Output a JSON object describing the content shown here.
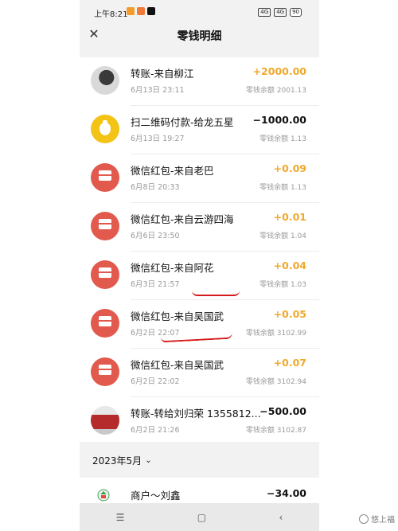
{
  "status_bar": {
    "time": "上午8:21",
    "net_left": "4G",
    "net_right": "4G",
    "battery": "90"
  },
  "header": {
    "title": "零钱明细",
    "close_icon": "close-icon"
  },
  "transactions": [
    {
      "name": "转账-来自柳江",
      "date": "6月13日 23:11",
      "amount": "+2000.00",
      "balance": "零钱余额 2001.13",
      "avatar": "person-photo"
    },
    {
      "name": "扫二维码付款-给龙五星",
      "date": "6月13日 19:27",
      "amount": "−1000.00",
      "balance": "零钱余额 1.13",
      "avatar": "money-bag-icon"
    },
    {
      "name": "微信红包-来自老巴",
      "date": "6月8日 20:33",
      "amount": "+0.09",
      "balance": "零钱余额 1.13",
      "avatar": "red-packet-icon"
    },
    {
      "name": "微信红包-来自云游四海",
      "date": "6月6日 23:50",
      "amount": "+0.01",
      "balance": "零钱余额 1.04",
      "avatar": "red-packet-icon"
    },
    {
      "name": "微信红包-来自阿花",
      "date": "6月3日 21:57",
      "amount": "+0.04",
      "balance": "零钱余额 1.03",
      "avatar": "red-packet-icon"
    },
    {
      "name": "微信红包-来自吴国武",
      "date": "6月2日 22:07",
      "amount": "+0.05",
      "balance": "零钱余额 3102.99",
      "avatar": "red-packet-icon"
    },
    {
      "name": "微信红包-来自吴国武",
      "date": "6月2日 22:02",
      "amount": "+0.07",
      "balance": "零钱余额 3102.94",
      "avatar": "red-packet-icon"
    },
    {
      "name": "转账-转给刘归荣 1355812...",
      "date": "6月2日 21:26",
      "amount": "−500.00",
      "balance": "零钱余额 3102.87",
      "avatar": "group-photo"
    }
  ],
  "month_section": {
    "label": "2023年5月",
    "chevron": "chevron-down-icon"
  },
  "next_item": {
    "name": "商户～刘鑫",
    "amount": "−34.00"
  },
  "nav": {
    "menu": "☰",
    "home": "▢",
    "back": "‹"
  },
  "watermark": "悠上福"
}
